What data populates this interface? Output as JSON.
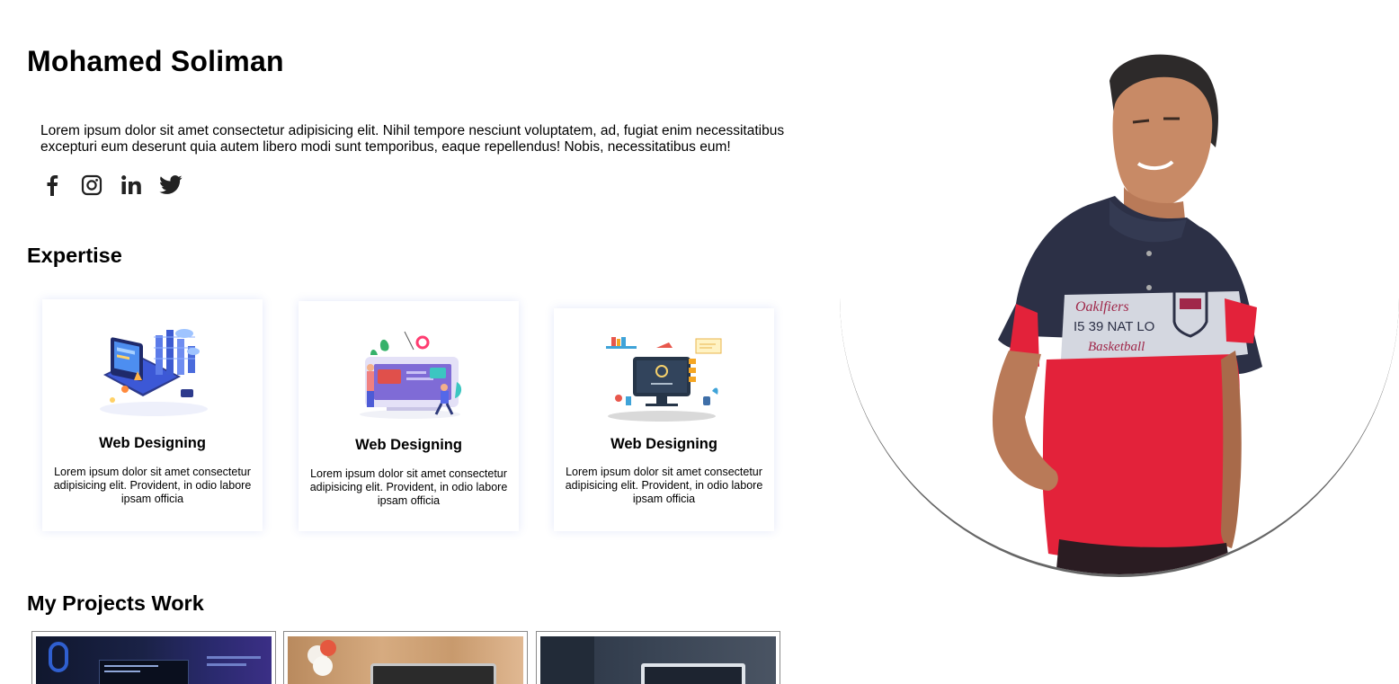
{
  "profile": {
    "name": "Mohamed Soliman",
    "bio": "Lorem ipsum dolor sit amet consectetur adipisicing elit. Nihil tempore nesciunt voluptatem, ad, fugiat enim necessitatibus excepturi eum deserunt quia autem libero modi sunt temporibus, eaque repellendus! Nobis, necessitatibus eum!"
  },
  "socials": [
    {
      "icon": "facebook-icon"
    },
    {
      "icon": "instagram-icon"
    },
    {
      "icon": "linkedin-icon"
    },
    {
      "icon": "twitter-icon"
    }
  ],
  "expertise": {
    "title": "Expertise",
    "cards": [
      {
        "title": "Web Designing",
        "description": "Lorem ipsum dolor sit amet consectetur adipisicing elit. Provident, in odio labore ipsam officia"
      },
      {
        "title": "Web Designing",
        "description": "Lorem ipsum dolor sit amet consectetur adipisicing elit. Provident, in odio labore ipsam officia"
      },
      {
        "title": "Web Designing",
        "description": "Lorem ipsum dolor sit amet consectetur adipisicing elit. Provident, in odio labore ipsam officia"
      }
    ]
  },
  "projects": {
    "title": "My Projects Work"
  }
}
